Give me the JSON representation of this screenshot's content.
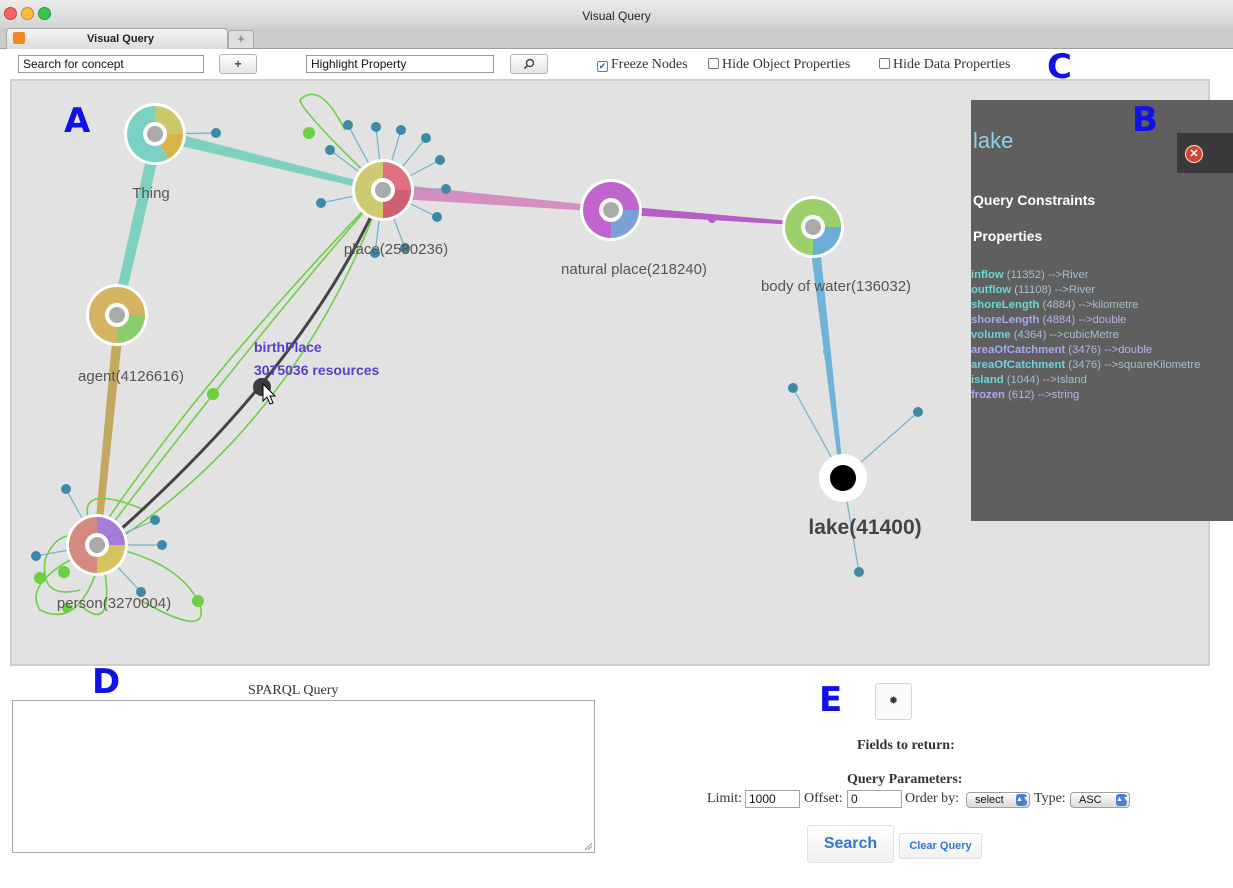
{
  "window": {
    "title": "Visual Query"
  },
  "tab": {
    "label": "Visual Query",
    "new_tab_label": "+"
  },
  "toolbar": {
    "search_concept_value": "Search for concept",
    "add_label": "+",
    "highlight_value": "Highlight Property",
    "freeze_nodes_label": "Freeze Nodes",
    "freeze_nodes_checked": true,
    "hide_object_label": "Hide Object Properties",
    "hide_data_label": "Hide Data Properties"
  },
  "letters": {
    "a": "A",
    "b": "B",
    "c": "C",
    "d": "D",
    "e": "E"
  },
  "graph": {
    "nodes": {
      "thing": "Thing",
      "place": "place(2580236)",
      "natural_place": "natural place(218240)",
      "body_of_water": "body of water(136032)",
      "agent": "agent(4126616)",
      "person": "person(3270004)",
      "lake": "lake(41400)"
    },
    "edge_tooltip": {
      "property": "birthPlace",
      "count": "3075036 resources"
    }
  },
  "panel": {
    "title": "lake",
    "query_constraints": "Query Constraints",
    "properties_heading": "Properties",
    "properties": [
      {
        "name": "inflow",
        "rest": " (11352) -->River",
        "kind": "object"
      },
      {
        "name": "outflow",
        "rest": " (11108) -->River",
        "kind": "object"
      },
      {
        "name": "shoreLength",
        "rest": " (4884) -->kilometre",
        "kind": "object"
      },
      {
        "name": "shoreLength",
        "rest": " (4884) -->double",
        "kind": "data"
      },
      {
        "name": "volume",
        "rest": " (4364) -->cubicMetre",
        "kind": "object"
      },
      {
        "name": "areaOfCatchment",
        "rest": " (3476) -->double",
        "kind": "data"
      },
      {
        "name": "areaOfCatchment",
        "rest": " (3476) -->squareKilometre",
        "kind": "object"
      },
      {
        "name": "island",
        "rest": " (1044) -->Island",
        "kind": "object"
      },
      {
        "name": "frozen",
        "rest": " (612) -->string",
        "kind": "data"
      }
    ]
  },
  "query": {
    "sparql_label": "SPARQL Query",
    "sparql_text": "",
    "fields_to_return": "Fields to return:",
    "query_parameters": "Query Parameters:",
    "limit_label": "Limit:",
    "limit_value": "1000",
    "offset_label": "Offset:",
    "offset_value": "0",
    "order_by_label": "Order by:",
    "order_by_value": "select",
    "type_label": "Type:",
    "type_value": "ASC",
    "search_label": "Search",
    "clear_label": "Clear Query"
  },
  "colors": {
    "object_property": "#6fd4d8",
    "data_property": "#a8a8f4",
    "annotation_letters": "#1010e8",
    "edge_tooltip": "#5a3ec8"
  }
}
